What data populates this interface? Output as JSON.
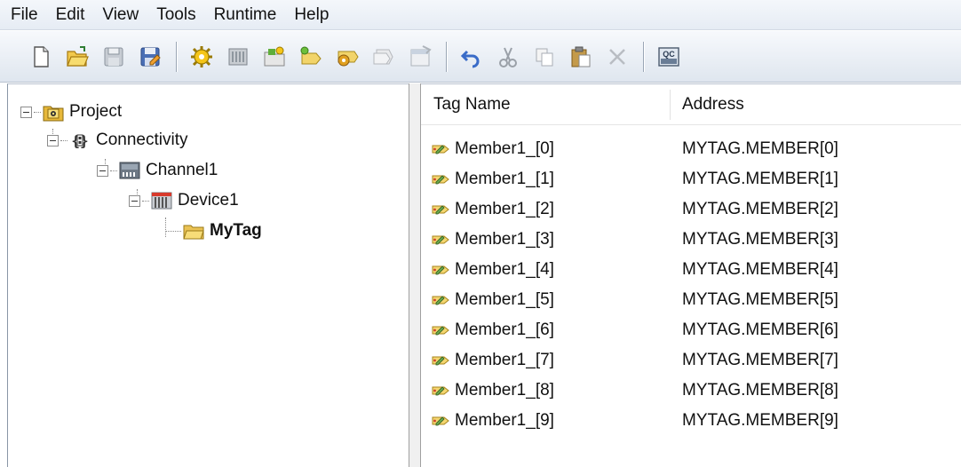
{
  "menu": [
    "File",
    "Edit",
    "View",
    "Tools",
    "Runtime",
    "Help"
  ],
  "toolbar": {
    "buttons": [
      {
        "icon": "new-icon"
      },
      {
        "icon": "open-icon"
      },
      {
        "icon": "save-icon"
      },
      {
        "icon": "save-as-icon"
      },
      {
        "icon": "new-channel-icon"
      },
      {
        "icon": "new-device-icon"
      },
      {
        "icon": "new-tag-group-icon"
      },
      {
        "icon": "new-tag-icon"
      },
      {
        "icon": "bulk-tag-icon"
      },
      {
        "icon": "duplicate-icon"
      },
      {
        "icon": "properties-icon"
      },
      {
        "icon": "undo-icon"
      },
      {
        "icon": "cut-icon"
      },
      {
        "icon": "copy-icon"
      },
      {
        "icon": "paste-icon"
      },
      {
        "icon": "delete-icon"
      },
      {
        "icon": "quick-client-icon"
      }
    ],
    "qc_label": "QC"
  },
  "tree": {
    "project": "Project",
    "connectivity": "Connectivity",
    "channel": "Channel1",
    "device": "Device1",
    "tag_group": "MyTag"
  },
  "table": {
    "columns": [
      "Tag Name",
      "Address"
    ],
    "rows": [
      {
        "name": "Member1_[0]",
        "address": "MYTAG.MEMBER[0]"
      },
      {
        "name": "Member1_[1]",
        "address": "MYTAG.MEMBER[1]"
      },
      {
        "name": "Member1_[2]",
        "address": "MYTAG.MEMBER[2]"
      },
      {
        "name": "Member1_[3]",
        "address": "MYTAG.MEMBER[3]"
      },
      {
        "name": "Member1_[4]",
        "address": "MYTAG.MEMBER[4]"
      },
      {
        "name": "Member1_[5]",
        "address": "MYTAG.MEMBER[5]"
      },
      {
        "name": "Member1_[6]",
        "address": "MYTAG.MEMBER[6]"
      },
      {
        "name": "Member1_[7]",
        "address": "MYTAG.MEMBER[7]"
      },
      {
        "name": "Member1_[8]",
        "address": "MYTAG.MEMBER[8]"
      },
      {
        "name": "Member1_[9]",
        "address": "MYTAG.MEMBER[9]"
      }
    ]
  }
}
